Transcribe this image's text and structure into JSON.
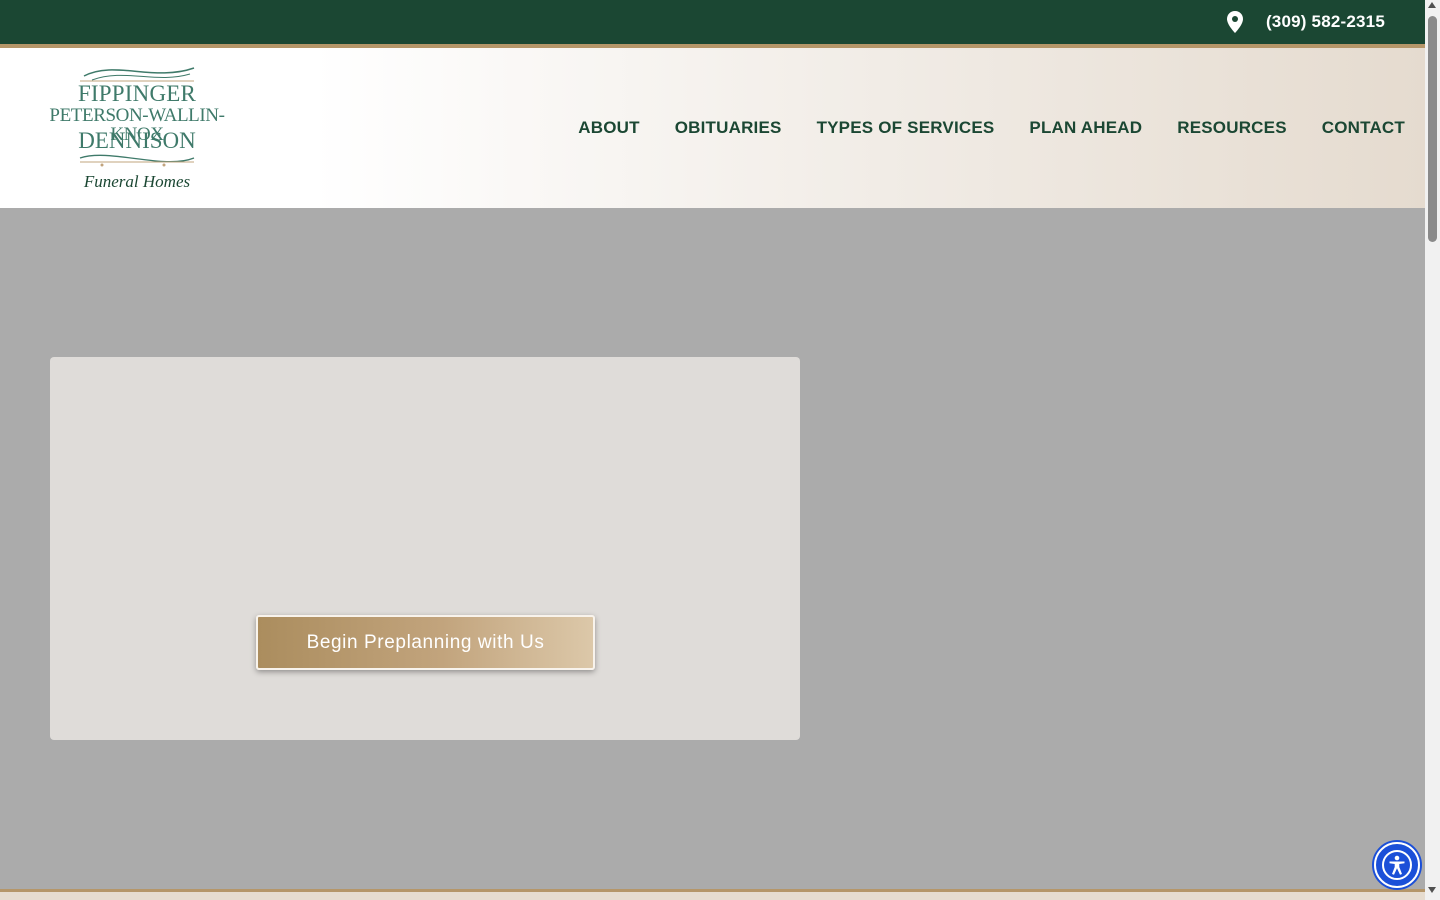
{
  "topbar": {
    "phone": "(309) 582-2315",
    "icon": "map-pin-icon"
  },
  "logo": {
    "line1": "FIPPINGER",
    "line2": "PETERSON-WALLIN-KNOX",
    "line3": "DENNISON",
    "line4": "Funeral Homes"
  },
  "nav": {
    "items": [
      {
        "label": "ABOUT"
      },
      {
        "label": "OBITUARIES"
      },
      {
        "label": "TYPES OF SERVICES"
      },
      {
        "label": "PLAN AHEAD"
      },
      {
        "label": "RESOURCES"
      },
      {
        "label": "CONTACT"
      }
    ]
  },
  "hero": {
    "cta_label": "Begin Preplanning with Us"
  },
  "accessibility": {
    "icon": "accessibility-icon"
  },
  "colors": {
    "brand_green": "#1b4733",
    "accent_gold": "#b59669",
    "logo_teal": "#3f7a6a",
    "hero_bg": "#ababab",
    "card_bg": "#dfdcd9",
    "a11y_blue": "#1b4fd8"
  }
}
